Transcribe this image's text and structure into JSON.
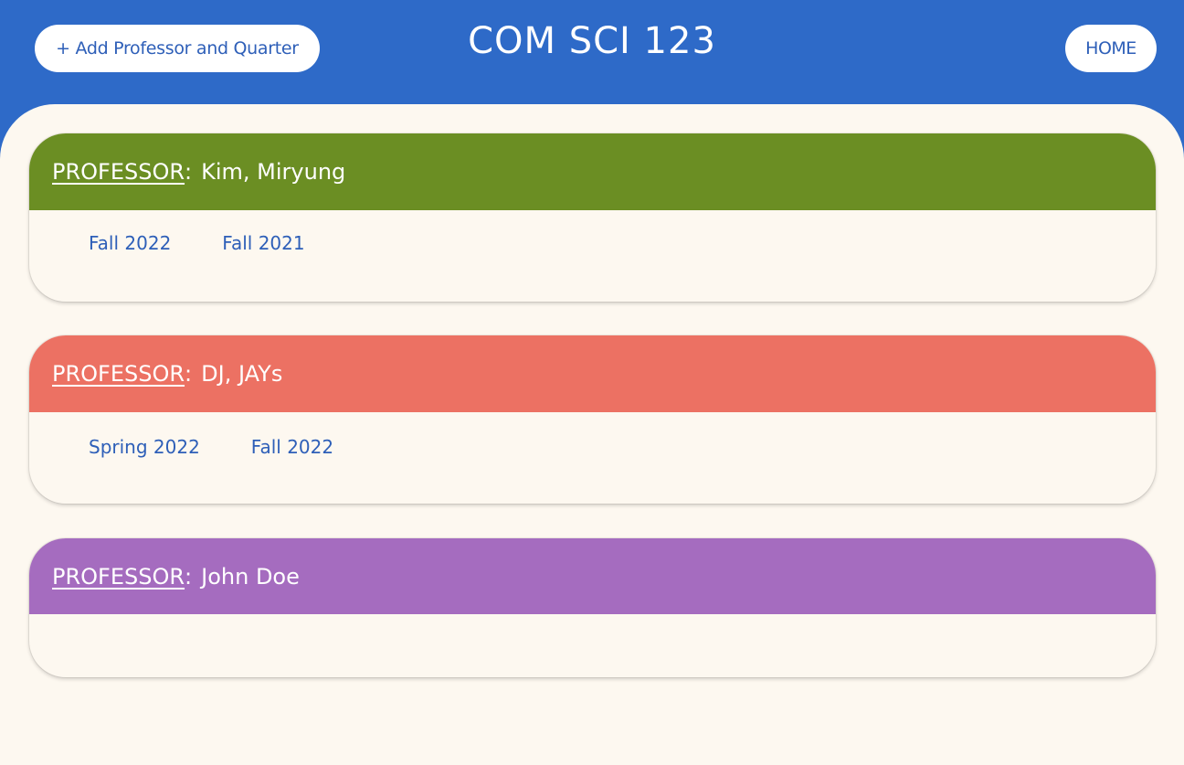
{
  "header": {
    "add_button_label": "+ Add Professor and Quarter",
    "title": "COM SCI 123",
    "home_button_label": "HOME"
  },
  "professor_label": "PROFESSOR",
  "professor_colon": ":",
  "colors": {
    "header_bg": "#2e6ac8",
    "page_bg": "#fdf8f0",
    "link": "#2e5fb8"
  },
  "professors": [
    {
      "name": "Kim, Miryung",
      "color": "#6b8e23",
      "quarters": [
        "Fall 2022",
        "Fall 2021"
      ]
    },
    {
      "name": "DJ, JAYs",
      "color": "#ec7163",
      "quarters": [
        "Spring 2022",
        "Fall 2022"
      ]
    },
    {
      "name": "John Doe",
      "color": "#a56cbf",
      "quarters": []
    }
  ]
}
